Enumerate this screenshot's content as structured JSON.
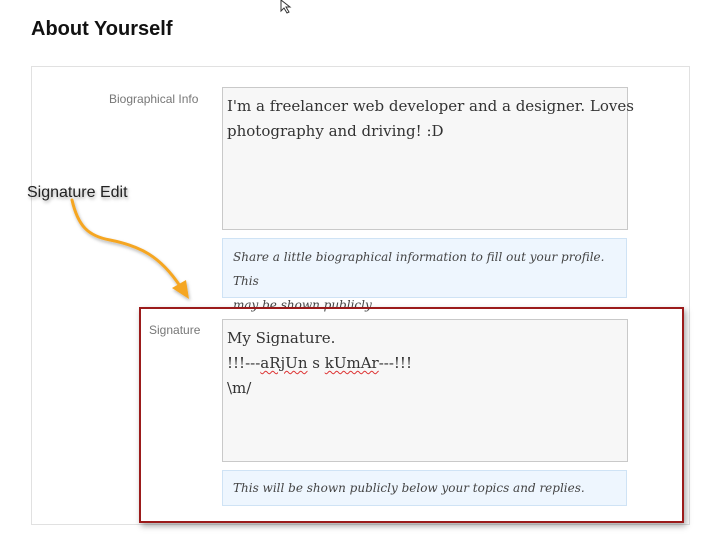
{
  "section": {
    "title": "About Yourself"
  },
  "bio": {
    "label": "Biographical Info",
    "value_lines": [
      "I'm a freelancer web developer and a designer. Loves",
      "photography and driving! :D"
    ],
    "hint_lines": [
      "Share a little biographical information to fill out your profile. This",
      "may be shown publicly."
    ]
  },
  "signature": {
    "label": "Signature",
    "line1": "My Signature.",
    "line2_parts": [
      "!!!---",
      "aRjUn",
      " s ",
      "kUmAr",
      "---!!!"
    ],
    "line3": "\\m/",
    "hint": "This will be shown publicly below your topics and replies."
  },
  "annotation": {
    "label": "Signature Edit",
    "box_color": "#9b1b1b",
    "arrow_color": "#f5a623"
  },
  "icons": {
    "cursor": "mouse-pointer-icon"
  }
}
